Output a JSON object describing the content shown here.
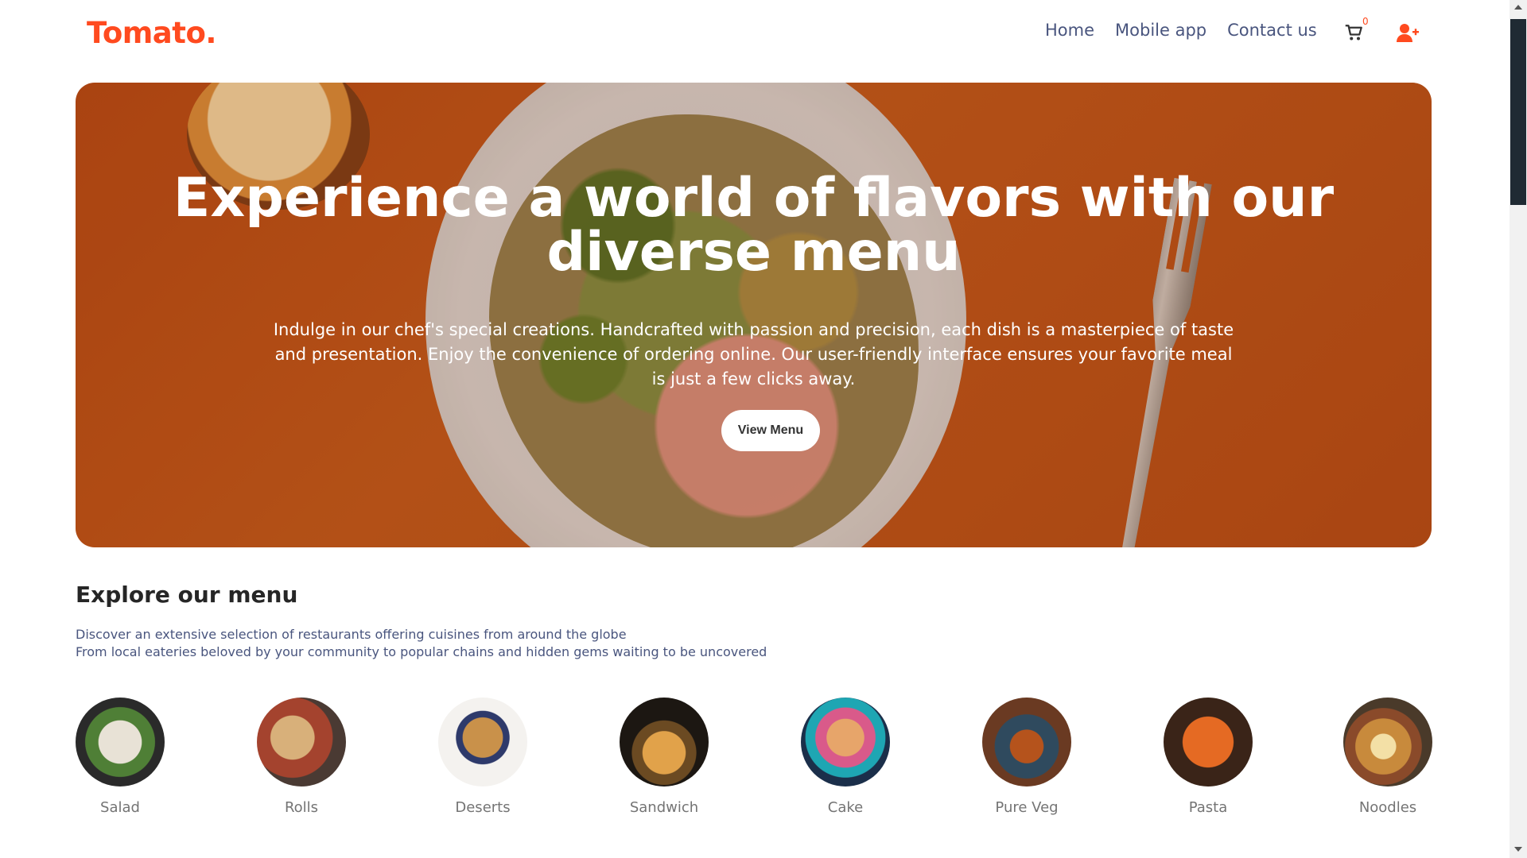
{
  "brand": {
    "logo": "Tomato.",
    "accent": "#ff4a1f"
  },
  "nav": {
    "links": [
      "Home",
      "Mobile app",
      "Contact us"
    ],
    "cart_count": "0",
    "cart_icon": "cart-icon",
    "user_icon": "user-add-icon"
  },
  "hero": {
    "title": "Experience a world of flavors with our diverse menu",
    "text": "Indulge in our chef's special creations. Handcrafted with passion and precision, each dish is a masterpiece of taste and presentation. Enjoy the convenience of ordering online. Our user-friendly interface ensures your favorite meal is just a few clicks away.",
    "button": "View Menu"
  },
  "explore": {
    "title": "Explore our menu",
    "desc_line1": "Discover an extensive selection of restaurants offering cuisines from around the globe",
    "desc_line2": "From local eateries beloved by your community to popular chains and hidden gems waiting to be uncovered",
    "items": [
      "Salad",
      "Rolls",
      "Deserts",
      "Sandwich",
      "Cake",
      "Pure Veg",
      "Pasta",
      "Noodles"
    ]
  }
}
